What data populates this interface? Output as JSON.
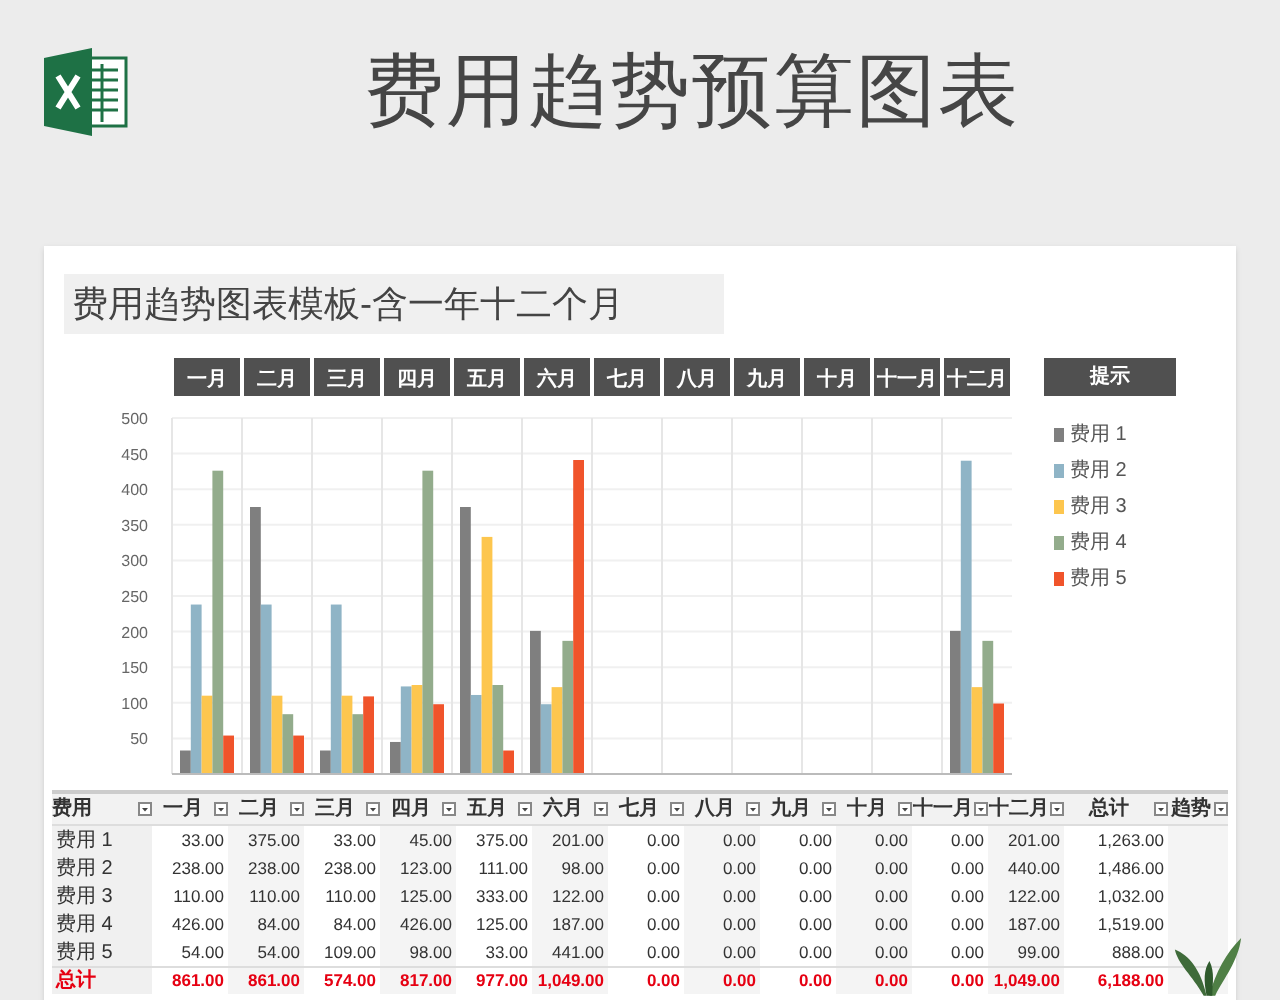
{
  "header": {
    "title": "费用趋势预算图表"
  },
  "sheet": {
    "subtitle": "费用趋势图表模板-含一年十二个月",
    "chart": {
      "legend_title": "提示",
      "chart_data": {
        "type": "bar",
        "grid": true,
        "categories": [
          "一月",
          "二月",
          "三月",
          "四月",
          "五月",
          "六月",
          "七月",
          "八月",
          "九月",
          "十月",
          "十一月",
          "十二月"
        ],
        "ylim": [
          0,
          500
        ],
        "yticks": [
          50,
          100,
          150,
          200,
          250,
          300,
          350,
          400,
          450,
          500
        ],
        "series": [
          {
            "name": "费用 1",
            "color": "#7f7f7f",
            "values": [
              33,
              375,
              33,
              45,
              375,
              201,
              0,
              0,
              0,
              0,
              0,
              201
            ]
          },
          {
            "name": "费用 2",
            "color": "#8fb4c6",
            "values": [
              238,
              238,
              238,
              123,
              111,
              98,
              0,
              0,
              0,
              0,
              0,
              440
            ]
          },
          {
            "name": "费用 3",
            "color": "#fdc64e",
            "values": [
              110,
              110,
              110,
              125,
              333,
              122,
              0,
              0,
              0,
              0,
              0,
              122
            ]
          },
          {
            "name": "费用 4",
            "color": "#93ac8c",
            "values": [
              426,
              84,
              84,
              426,
              125,
              187,
              0,
              0,
              0,
              0,
              0,
              187
            ]
          },
          {
            "name": "费用 5",
            "color": "#f0542b",
            "values": [
              54,
              54,
              109,
              98,
              33,
              441,
              0,
              0,
              0,
              0,
              0,
              99
            ]
          }
        ]
      }
    },
    "table": {
      "columns": [
        "费用",
        "一月",
        "二月",
        "三月",
        "四月",
        "五月",
        "六月",
        "七月",
        "八月",
        "九月",
        "十月",
        "十一月",
        "十二月",
        "总计",
        "趋势"
      ],
      "rows": [
        {
          "kind": "data",
          "cells": [
            "费用 1",
            "33.00",
            "375.00",
            "33.00",
            "45.00",
            "375.00",
            "201.00",
            "0.00",
            "0.00",
            "0.00",
            "0.00",
            "0.00",
            "201.00",
            "1,263.00"
          ]
        },
        {
          "kind": "data",
          "cells": [
            "费用 2",
            "238.00",
            "238.00",
            "238.00",
            "123.00",
            "111.00",
            "98.00",
            "0.00",
            "0.00",
            "0.00",
            "0.00",
            "0.00",
            "440.00",
            "1,486.00"
          ]
        },
        {
          "kind": "data",
          "cells": [
            "费用 3",
            "110.00",
            "110.00",
            "110.00",
            "125.00",
            "333.00",
            "122.00",
            "0.00",
            "0.00",
            "0.00",
            "0.00",
            "0.00",
            "122.00",
            "1,032.00"
          ]
        },
        {
          "kind": "data",
          "cells": [
            "费用 4",
            "426.00",
            "84.00",
            "84.00",
            "426.00",
            "125.00",
            "187.00",
            "0.00",
            "0.00",
            "0.00",
            "0.00",
            "0.00",
            "187.00",
            "1,519.00"
          ]
        },
        {
          "kind": "data",
          "cells": [
            "费用 5",
            "54.00",
            "54.00",
            "109.00",
            "98.00",
            "33.00",
            "441.00",
            "0.00",
            "0.00",
            "0.00",
            "0.00",
            "0.00",
            "99.00",
            "888.00"
          ]
        },
        {
          "kind": "total",
          "cells": [
            "总计",
            "861.00",
            "861.00",
            "574.00",
            "817.00",
            "977.00",
            "1,049.00",
            "0.00",
            "0.00",
            "0.00",
            "0.00",
            "0.00",
            "1,049.00",
            "6,188.00"
          ]
        }
      ]
    }
  }
}
